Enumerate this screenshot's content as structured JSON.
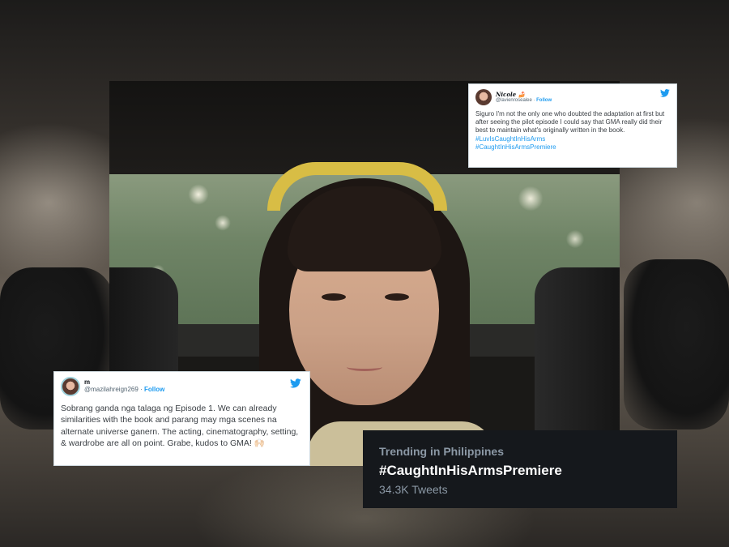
{
  "tweet_top": {
    "display_name": "Nicole 🍰",
    "handle": "@lavienrosealee",
    "separator": "·",
    "follow_label": "Follow",
    "body": "Siguro I'm not the only one who doubted the adaptation at first but after seeing the pilot episode I could say that GMA really did their best to maintain what's originally written in the book.",
    "hashtags": [
      "#LuvIsCaughtInHisArms",
      "#CaughtInHisArmsPremiere"
    ]
  },
  "tweet_bottom": {
    "display_name": "m",
    "handle": "@mazilahreign269",
    "separator": "·",
    "follow_label": "Follow",
    "body": "Sobrang ganda nga talaga ng Episode 1. We can already similarities with the book and parang may mga scenes na alternate universe ganern. The acting, cinematography, setting, & wardrobe are all on point. Grabe, kudos to GMA! 🙌🏻"
  },
  "trending": {
    "context": "Trending in Philippines",
    "hashtag": "#CaughtInHisArmsPremiere",
    "count": "34.3K Tweets"
  },
  "colors": {
    "twitter_blue": "#1d9bf0",
    "trend_bg": "#15181c",
    "headband": "#d8bd45"
  },
  "icons": [
    "twitter-bird-icon",
    "avatar"
  ]
}
